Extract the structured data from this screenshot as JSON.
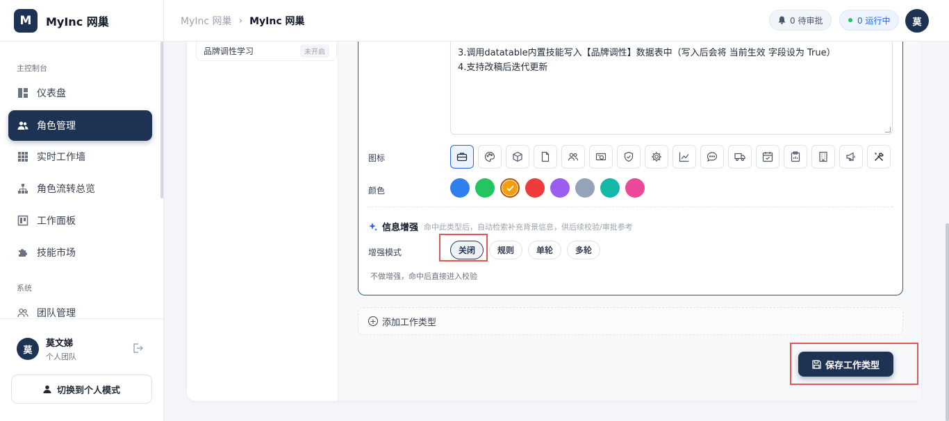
{
  "app": {
    "logo_letter": "M",
    "name": "MyInc 网巢"
  },
  "sidebar": {
    "section_main": "主控制台",
    "section_system": "系统",
    "items": [
      {
        "label": "仪表盘",
        "icon": "dashboard-icon"
      },
      {
        "label": "角色管理",
        "icon": "users-icon",
        "active": true
      },
      {
        "label": "实时工作墙",
        "icon": "grid-icon"
      },
      {
        "label": "角色流转总览",
        "icon": "hierarchy-icon"
      },
      {
        "label": "工作面板",
        "icon": "kanban-icon"
      },
      {
        "label": "技能市场",
        "icon": "puzzle-icon"
      },
      {
        "label": "团队管理",
        "icon": "team-icon"
      }
    ],
    "user": {
      "avatar": "莫",
      "name": "莫文娣",
      "team": "个人团队"
    },
    "switch_label": "切换到个人模式"
  },
  "header": {
    "breadcrumb": [
      "MyInc 网巢",
      "MyInc 网巢"
    ],
    "pending": "0 待审批",
    "running": "0 运行中",
    "avatar": "莫"
  },
  "type_list": [
    {
      "name": "品牌调性学习",
      "badge": "未开启"
    }
  ],
  "form": {
    "description_lines": [
      "3.调用datatable内置技能写入【品牌调性】数据表中（写入后会将 当前生效 字段设为 True）",
      "4.支持改稿后迭代更新"
    ],
    "icon_label": "图标",
    "icons": [
      "briefcase-icon",
      "palette-icon",
      "box-icon",
      "document-icon",
      "users-icon",
      "money-icon",
      "shield-icon",
      "gear-icon",
      "chart-icon",
      "chat-icon",
      "truck-icon",
      "calendar-icon",
      "clipboard-icon",
      "building-icon",
      "megaphone-icon",
      "tools-icon"
    ],
    "selected_icon": 0,
    "color_label": "颜色",
    "colors": [
      "#2f80ed",
      "#22c55e",
      "#f59e0b",
      "#ef3b3b",
      "#9b5cf0",
      "#94a3b8",
      "#14b8a6",
      "#ec4899"
    ],
    "selected_color": 2,
    "enhance_title": "信息增强",
    "enhance_desc": "命中此类型后，自动检索补充背景信息，供后续校验/审批参考",
    "mode_label": "增强模式",
    "modes": [
      "关闭",
      "规则",
      "单轮",
      "多轮"
    ],
    "selected_mode": 0,
    "mode_hint": "不做增强，命中后直接进入校验"
  },
  "add_type_label": "添加工作类型",
  "save_label": "保存工作类型"
}
